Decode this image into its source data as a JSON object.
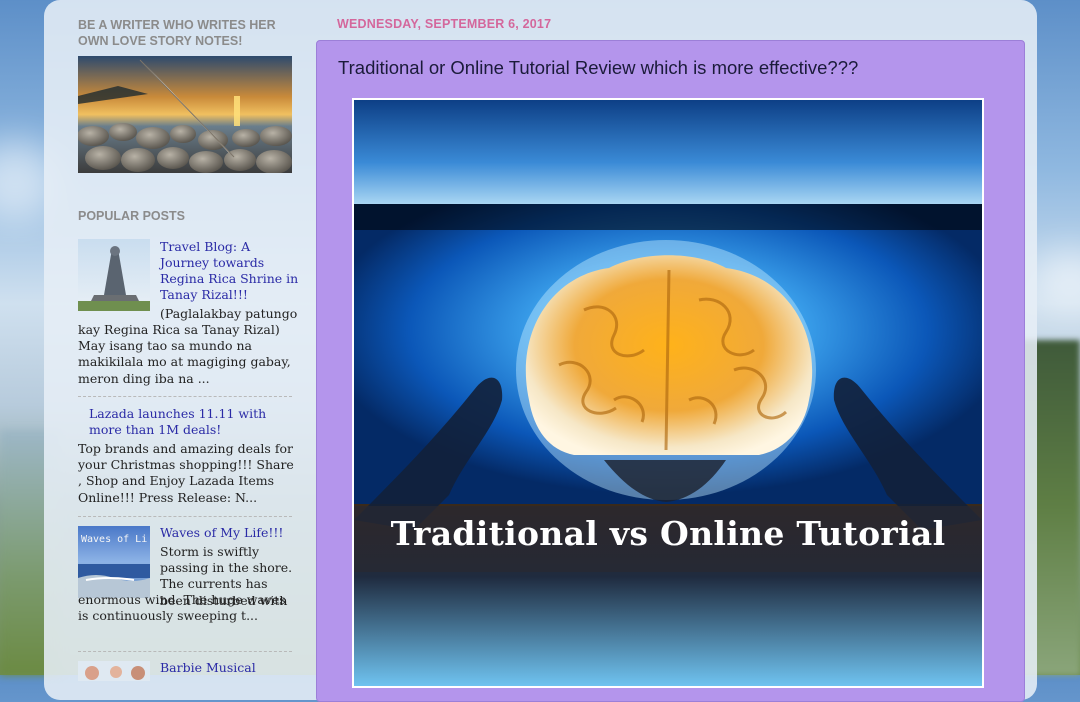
{
  "sidebar": {
    "writer_heading": "BE A WRITER WHO WRITES HER OWN LOVE STORY NOTES!",
    "popular_heading": "POPULAR POSTS",
    "posts": [
      {
        "title": "Travel Blog: A Journey towards Regina Rica Shrine in Tanay Rizal!!!",
        "snippet_a": "(Paglalakbay patungo",
        "snippet_b": "kay Regina Rica sa Tanay Rizal) May isang tao sa mundo na makikilala mo at magiging gabay, meron ding iba na ..."
      },
      {
        "title": "Lazada launches 11.11 with more than 1M deals!",
        "snippet": "Top brands and amazing deals for your Christmas shopping!!! Share , Shop and Enjoy Lazada Items Online!!! Press Release: N..."
      },
      {
        "title": "Waves of My Life!!!",
        "thumb_text": "Waves of Li",
        "snippet_a": "Storm is swiftly passing in the shore. The currents has been disturbed with",
        "snippet_b": "enormous wind. The huge waves is continuously sweeping t..."
      },
      {
        "title": "Barbie Musical"
      }
    ]
  },
  "main": {
    "date": "WEDNESDAY, SEPTEMBER 6, 2017",
    "post_title": "Traditional or Online Tutorial Review which is more effective???",
    "image_caption": "Traditional vs Online Tutorial"
  },
  "colors": {
    "post_bg": "#b495ec",
    "date_color": "#d4679c",
    "link_color": "#2a2aa6"
  }
}
